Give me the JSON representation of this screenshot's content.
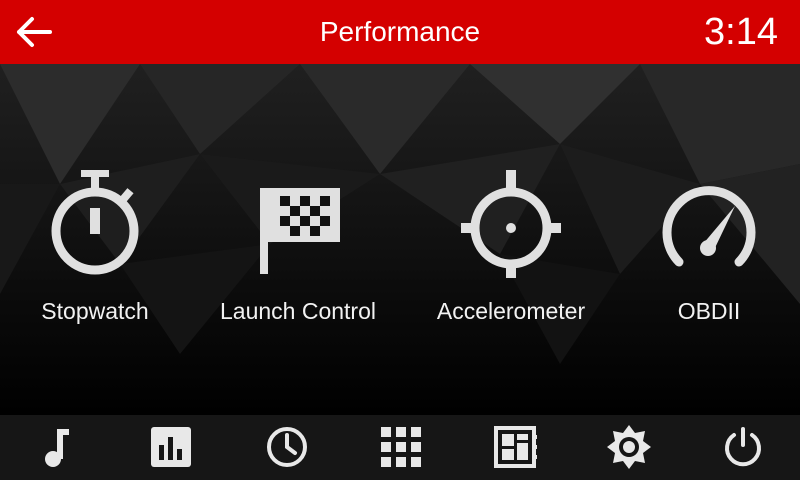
{
  "header": {
    "title": "Performance",
    "time": "3:14",
    "back_icon": "arrow-left-icon",
    "accent_color": "#d40000"
  },
  "tiles": [
    {
      "label": "Stopwatch",
      "icon": "stopwatch-icon"
    },
    {
      "label": "Launch Control",
      "icon": "checkered-flag-icon"
    },
    {
      "label": "Accelerometer",
      "icon": "crosshair-icon"
    },
    {
      "label": "OBDII",
      "icon": "speedometer-gauge-icon"
    }
  ],
  "dock": {
    "items": [
      {
        "icon": "music-note-icon"
      },
      {
        "icon": "bar-chart-icon"
      },
      {
        "icon": "clock-icon"
      },
      {
        "icon": "app-grid-icon"
      },
      {
        "icon": "dashboard-layout-icon"
      },
      {
        "icon": "brightness-gear-icon"
      },
      {
        "icon": "power-icon"
      }
    ]
  }
}
